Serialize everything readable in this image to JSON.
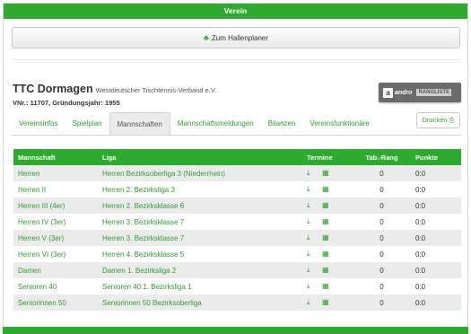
{
  "header": {
    "title": "Verein"
  },
  "hall_planner": {
    "icon": "sitemap-icon",
    "label": "Zum Hallenplaner"
  },
  "club": {
    "name": "TTC Dormagen",
    "federation": "Westdeutscher Tischtennis-Verband e.V.",
    "info": "VNr.: 11707, Gründungsjahr: 1955"
  },
  "andro_badge": {
    "brand": "andro",
    "label": "RANGLISTE"
  },
  "tabs": [
    {
      "label": "Vereinsinfos",
      "active": false
    },
    {
      "label": "Spielplan",
      "active": false
    },
    {
      "label": "Mannschaften",
      "active": true
    },
    {
      "label": "Mannschaftsmeldungen",
      "active": false
    },
    {
      "label": "Bilanzen",
      "active": false
    },
    {
      "label": "Vereinsfunktionäre",
      "active": false
    }
  ],
  "print": {
    "label": "Drucken",
    "icon": "print-icon"
  },
  "table": {
    "columns": [
      "Mannschaft",
      "Liga",
      "Termine",
      "Tab.-Rang",
      "Punkte"
    ],
    "rows": [
      {
        "team": "Herren",
        "league": "Herren Bezirksoberliga 3 (Niederrhein)",
        "rank": "0",
        "points": "0:0"
      },
      {
        "team": "Herren II",
        "league": "Herren 2. Bezirksliga 3",
        "rank": "0",
        "points": "0:0"
      },
      {
        "team": "Herren III (4er)",
        "league": "Herren 2. Bezirksklasse 6",
        "rank": "0",
        "points": "0:0"
      },
      {
        "team": "Herren IV (3er)",
        "league": "Herren 3. Bezirksklasse 7",
        "rank": "0",
        "points": "0:0"
      },
      {
        "team": "Herren V (3er)",
        "league": "Herren 3. Bezirksklasse 7",
        "rank": "0",
        "points": "0:0"
      },
      {
        "team": "Herren VI (3er)",
        "league": "Herren 4. Bezirksklasse 5",
        "rank": "0",
        "points": "0:0"
      },
      {
        "team": "Damen",
        "league": "Damen 1. Bezirksliga 2",
        "rank": "0",
        "points": "0:0"
      },
      {
        "team": "Senioren 40",
        "league": "Senioren 40 1. Bezirksliga 1",
        "rank": "0",
        "points": "0:0"
      },
      {
        "team": "Seniorinnen 50",
        "league": "Seniorinnen 50 Bezirksoberliga",
        "rank": "0",
        "points": "0:0"
      }
    ],
    "row_icons": [
      "download-icon",
      "calendar-icon"
    ]
  },
  "colors": {
    "brand_green": "#2eaa2e",
    "link_green": "#2e9c2e",
    "stripe_gray": "#ebebeb"
  }
}
